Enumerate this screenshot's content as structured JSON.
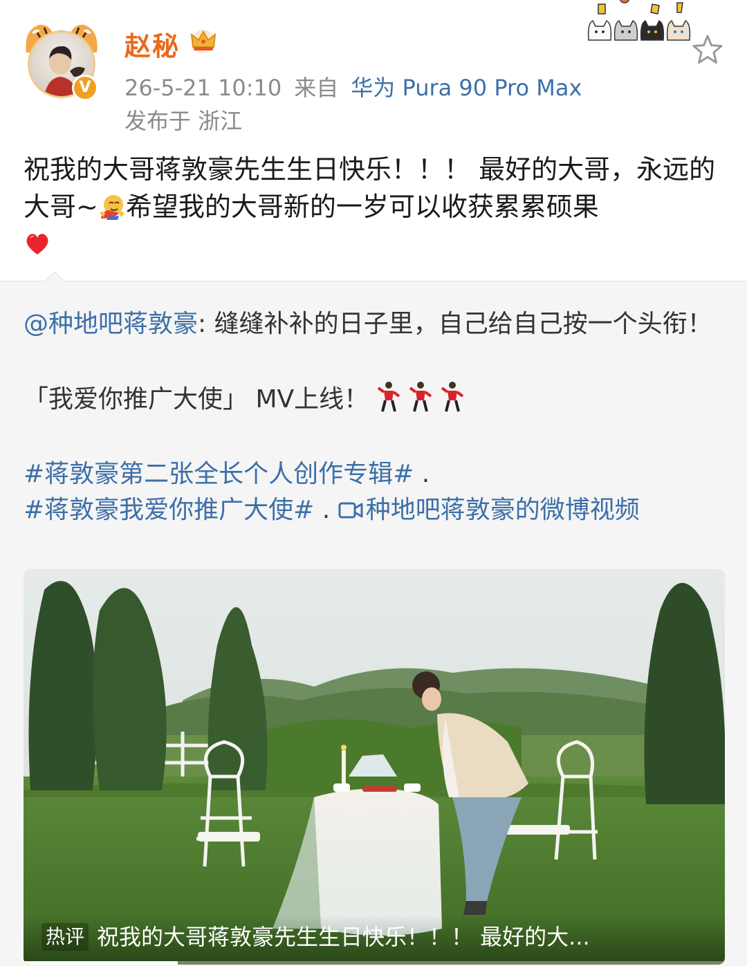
{
  "header": {
    "username": "赵秘",
    "verified_mark": "V",
    "timestamp": "26-5-21 10:10",
    "source_prefix": "来自",
    "device": "华为 Pura 90 Pro Max",
    "location": "发布于 浙江",
    "icons": [
      "tiger-avatar",
      "crown-icon",
      "sticker-cats",
      "star-icon"
    ]
  },
  "post": {
    "text": "祝我的大哥蒋敦豪先生生日快乐！！！ 最好的大哥，永远的大哥~",
    "text_after_emoji": "希望我的大哥新的一岁可以收获累累硕果",
    "emojis": [
      "hug-emoji",
      "heart-icon"
    ]
  },
  "repost": {
    "mention": "@种地吧蒋敦豪",
    "text": ": 缝缝补补的日子里，自己给自己按一个头衔！",
    "line2": "「我爱你推广大使」 MV上线！",
    "topic1": "#蒋敦豪第二张全长个人创作专辑#",
    "topic1_suffix": " .",
    "topic2": "#蒋敦豪我爱你推广大使#",
    "topic2_suffix": " . ",
    "video_link": "种地吧蒋敦豪的微博视频"
  },
  "video": {
    "hot_tag": "热评",
    "caption": "祝我的大哥蒋敦豪先生生日快乐！！！ 最好的大...",
    "progress": 0.22
  }
}
